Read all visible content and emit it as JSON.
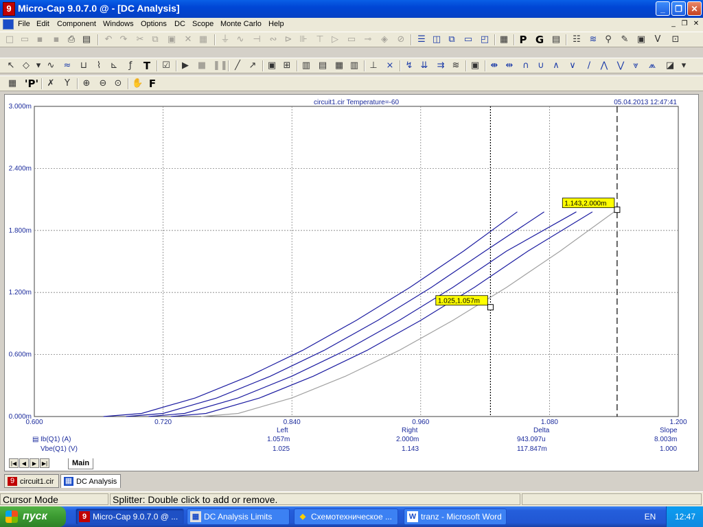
{
  "window": {
    "title": "Micro-Cap 9.0.7.0 @ - [DC Analysis]",
    "icon": "9",
    "min_glyph": "_",
    "max_glyph": "❐",
    "close_glyph": "✕"
  },
  "menu": {
    "items": [
      "File",
      "Edit",
      "Component",
      "Windows",
      "Options",
      "DC",
      "Scope",
      "Monte Carlo",
      "Help"
    ],
    "mdi_min": "_",
    "mdi_restore": "❐",
    "mdi_close": "✕"
  },
  "toolbar_text": {
    "p_icon": "P",
    "g_icon": "G",
    "t_icon": "T",
    "p_prime": "'P'",
    "f_icon": "F"
  },
  "plot": {
    "title": "circuit1.cir Temperature=-60",
    "timestamp": "05.04.2013 12:47:41",
    "colors": {
      "curve": "#1a1aa0",
      "curve_last": "#a0a0a0",
      "grid": "#808080",
      "axis_text": "#1a2a9c",
      "label_bg": "#ffff00"
    }
  },
  "chart_data": {
    "type": "line",
    "title": "circuit1.cir Temperature=-60",
    "xlabel": "Vbe(Q1) (V)",
    "ylabel": "Ib(Q1) (A)",
    "xlim": [
      0.6,
      1.2
    ],
    "ylim": [
      0,
      0.003
    ],
    "x_ticks": [
      "0.600",
      "0.720",
      "0.840",
      "0.960",
      "1.080",
      "1.200"
    ],
    "y_ticks": [
      "0.000m",
      "0.600m",
      "1.200m",
      "1.800m",
      "2.400m",
      "3.000m"
    ],
    "grid": true,
    "series": [
      {
        "x": [
          0.6645,
          0.7,
          0.75,
          0.8,
          0.85,
          0.9,
          0.95,
          1.0,
          1.05
        ],
        "y": [
          0.0,
          3e-05,
          0.00018,
          0.00039,
          0.00064,
          0.00093,
          0.00125,
          0.0016,
          0.00198
        ]
      },
      {
        "x": [
          0.6855,
          0.72,
          0.77,
          0.82,
          0.87,
          0.92,
          0.97,
          1.02,
          1.075
        ],
        "y": [
          0.0,
          3e-05,
          0.00018,
          0.00039,
          0.00064,
          0.00093,
          0.00125,
          0.0016,
          0.00198
        ]
      },
      {
        "x": [
          0.7065,
          0.74,
          0.79,
          0.84,
          0.89,
          0.94,
          0.99,
          1.04,
          1.105
        ],
        "y": [
          0.0,
          3e-05,
          0.00018,
          0.00039,
          0.00064,
          0.00093,
          0.00125,
          0.0016,
          0.00198
        ]
      },
      {
        "x": [
          0.7275,
          0.76,
          0.81,
          0.86,
          0.91,
          0.96,
          1.01,
          1.06,
          1.12
        ],
        "y": [
          0.0,
          3e-05,
          0.00018,
          0.00039,
          0.00064,
          0.00093,
          0.00125,
          0.0016,
          0.00198
        ]
      },
      {
        "x": [
          0.7555,
          0.79,
          0.84,
          0.89,
          0.94,
          0.99,
          1.04,
          1.09,
          1.143
        ],
        "y": [
          0.0,
          3e-05,
          0.00018,
          0.00039,
          0.00064,
          0.00093,
          0.00125,
          0.0016,
          0.002
        ]
      }
    ],
    "cursors": [
      {
        "x": 1.025,
        "y": 0.001057,
        "label": "1.025,1.057m",
        "style": "dotted"
      },
      {
        "x": 1.143,
        "y": 0.002,
        "label": "1.143,2.000m",
        "style": "dashed"
      }
    ]
  },
  "table": {
    "headers": [
      "Left",
      "Right",
      "Delta",
      "Slope"
    ],
    "rows": [
      {
        "name": "Ib(Q1) (A)",
        "values": [
          "1.057m",
          "2.000m",
          "943.097u",
          "8.003m"
        ]
      },
      {
        "name": "Vbe(Q1) (V)",
        "values": [
          "1.025",
          "1.143",
          "117.847m",
          "1.000"
        ]
      }
    ]
  },
  "page_tabs": {
    "active": "Main",
    "nav": [
      "|◀",
      "◀",
      "▶",
      "▶|"
    ]
  },
  "doc_tabs": [
    {
      "label": "circuit1.cir",
      "icon": "9"
    },
    {
      "label": "DC Analysis",
      "icon": "▦"
    }
  ],
  "status": {
    "mode": "Cursor Mode",
    "hint": "Splitter: Double click to add or remove."
  },
  "taskbar": {
    "start": "пуск",
    "tasks": [
      {
        "label": "Micro-Cap 9.0.7.0 @ ...",
        "icon": "9"
      },
      {
        "label": "DC Analysis Limits",
        "icon": "▦"
      },
      {
        "label": "Схемотехническое ...",
        "icon": "◆"
      },
      {
        "label": "tranz - Microsoft Word",
        "icon": "W"
      }
    ],
    "lang": "EN",
    "clock": "12:47"
  }
}
